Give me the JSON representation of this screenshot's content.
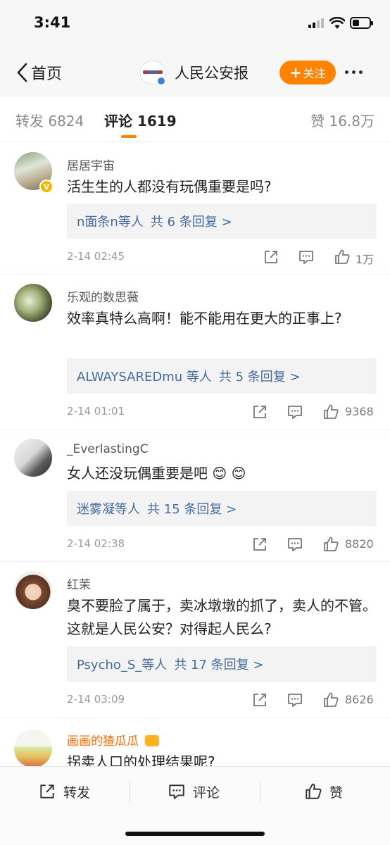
{
  "status_bar": {
    "time": "3:41"
  },
  "nav": {
    "back_label": "首页",
    "account_name": "人民公安报",
    "follow_label": "关注"
  },
  "tabs": {
    "repost": "转发 6824",
    "comment": "评论 1619",
    "like": "赞 16.8万"
  },
  "comments": [
    {
      "name": "居居宇宙",
      "text": "活生生的人都没有玩偶重要是吗?",
      "reply_who": "n面条n等人",
      "reply_count": "共 6 条回复 >",
      "time": "2-14 02:45",
      "likes": "1万"
    },
    {
      "name": "乐观的数思薇",
      "text": "效率真特么高啊！能不能用在更大的正事上?",
      "reply_who": "ALWAYSAREDmu 等人",
      "reply_count": "共 5 条回复 >",
      "time": "2-14 01:01",
      "likes": "9368"
    },
    {
      "name": "_EverlastingC",
      "text": "女人还没玩偶重要是吧 😊 😊",
      "reply_who": "迷雾凝等人",
      "reply_count": "共 15 条回复 >",
      "time": "2-14 02:38",
      "likes": "8820"
    },
    {
      "name": "红茉",
      "text": "臭不要脸了属于，卖冰墩墩的抓了，卖人的不管。这就是人民公安？对得起人民么?",
      "reply_who": "Psycho_S_等人",
      "reply_count": "共 17 条回复 >",
      "time": "2-14 03:09",
      "likes": "8626"
    },
    {
      "name": "画画的猹瓜瓜",
      "text": "拐卖人口的处理结果呢?"
    }
  ],
  "bottom_bar": {
    "repost": "转发",
    "comment": "评论",
    "like": "赞"
  },
  "colors": {
    "accent": "#ff8200",
    "link": "#466c9d",
    "verified_badge": "#f7b500"
  },
  "icons": [
    "back-chevron-icon",
    "share-icon",
    "reply-icon",
    "thumbs-up-icon",
    "more-icon"
  ]
}
